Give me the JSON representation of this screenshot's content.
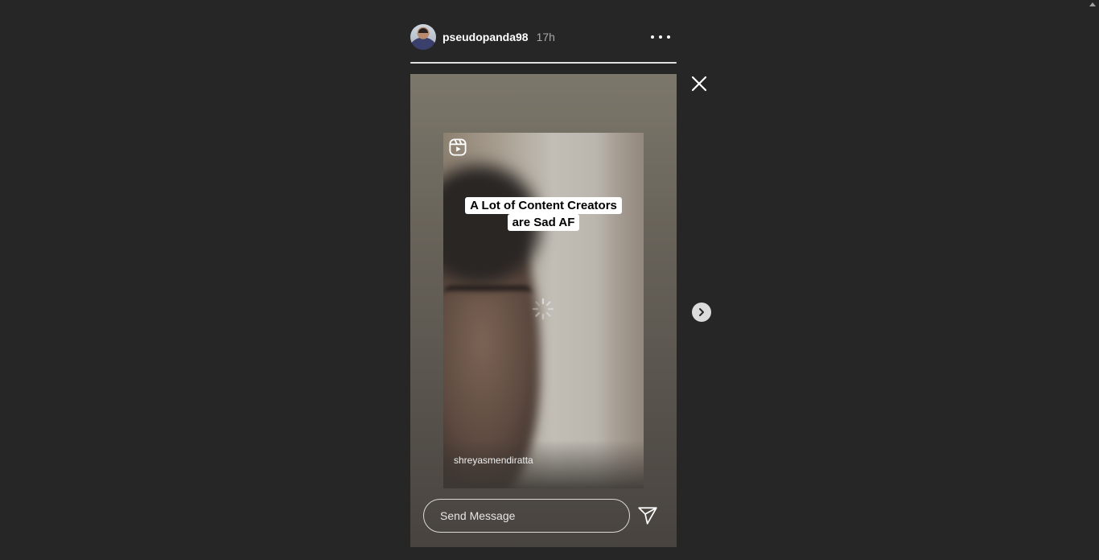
{
  "story": {
    "username": "pseudopanda98",
    "time": "17h",
    "progress": 1.0
  },
  "reel": {
    "caption_lines": [
      "A Lot of Content Creators",
      "are Sad AF"
    ],
    "credit": "shreyasmendiratta"
  },
  "message": {
    "placeholder": "Send Message"
  },
  "icons": {
    "more": "more-options-icon",
    "close": "close-icon",
    "next": "chevron-right-icon",
    "send": "send-icon",
    "reel": "reels-icon",
    "loading": "loading-spinner-icon"
  }
}
